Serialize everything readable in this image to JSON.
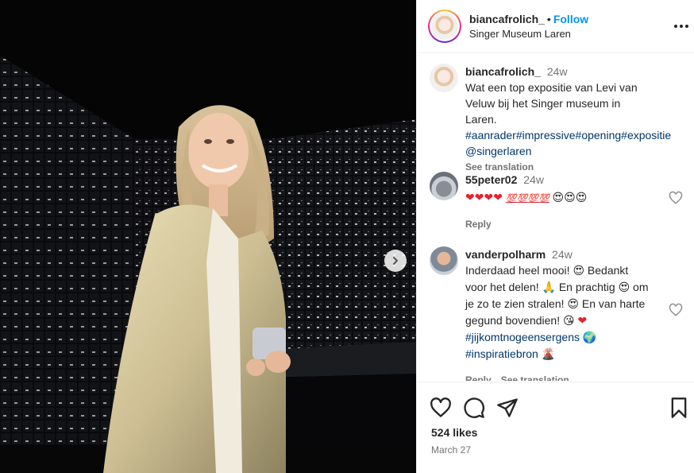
{
  "post": {
    "username": "biancafrolich_",
    "follow_label": "Follow",
    "location": "Singer Museum Laren",
    "likes": "524 likes",
    "date": "March 27"
  },
  "caption": {
    "username": "biancafrolich_",
    "time": "24w",
    "text": "Wat een top expositie van Levi van Veluw bij het Singer museum in Laren.",
    "hashtags": [
      "#aanrader",
      "#impressive",
      "#opening",
      "#expositie"
    ],
    "mention": "@singerlaren",
    "see_translation": "See translation"
  },
  "comments": [
    {
      "username": "55peter02",
      "time": "24w",
      "emojis": [
        "❤",
        "❤",
        "❤",
        "❤",
        "💯",
        "💯",
        "💯",
        "💯",
        "😍",
        "😍",
        "😍"
      ],
      "reply": "Reply"
    },
    {
      "username": "vanderpolharm",
      "time": "24w",
      "text_parts": [
        "Inderdaad heel mooi! ",
        " Bedankt voor het delen! ",
        " En prachtig ",
        " om je zo te zien stralen! ",
        " En van harte gegund bovendien! "
      ],
      "emojis": [
        "😍",
        "🙏",
        "😍",
        "😍",
        "😘",
        "❤",
        "🌍",
        "🌋"
      ],
      "hashtags": [
        "#jijkomtnogeensergens",
        "#inspiratiebron"
      ],
      "reply": "Reply",
      "see_translation": "See translation"
    }
  ],
  "icons": {
    "like": "heart-outline-icon",
    "comment": "comment-bubble-icon",
    "share": "paper-plane-icon",
    "save": "bookmark-icon",
    "more": "ellipsis-icon",
    "next": "chevron-right-icon"
  },
  "colors": {
    "link": "#0095f6",
    "hashtag": "#00376b",
    "muted": "#737373",
    "photo_bg": "#050506"
  }
}
